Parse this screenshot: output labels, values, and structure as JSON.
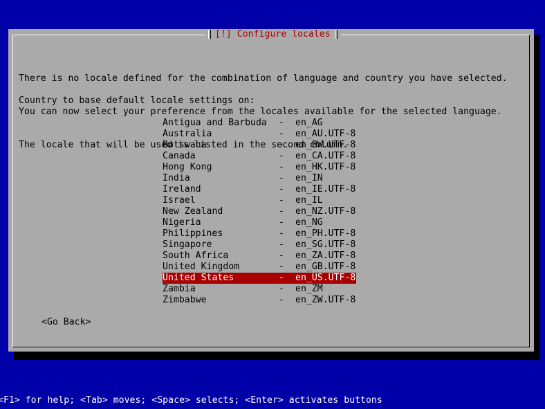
{
  "dialog": {
    "title": "[!] Configure locales",
    "description_lines": [
      "There is no locale defined for the combination of language and country you have selected.",
      "You can now select your preference from the locales available for the selected language.",
      "The locale that will be used is listed in the second column."
    ],
    "prompt": "Country to base default locale settings on:",
    "locales": [
      {
        "country": "Antigua and Barbuda",
        "locale": "en_AG"
      },
      {
        "country": "Australia",
        "locale": "en_AU.UTF-8"
      },
      {
        "country": "Botswana",
        "locale": "en_BW.UTF-8"
      },
      {
        "country": "Canada",
        "locale": "en_CA.UTF-8"
      },
      {
        "country": "Hong Kong",
        "locale": "en_HK.UTF-8"
      },
      {
        "country": "India",
        "locale": "en_IN"
      },
      {
        "country": "Ireland",
        "locale": "en_IE.UTF-8"
      },
      {
        "country": "Israel",
        "locale": "en_IL"
      },
      {
        "country": "New Zealand",
        "locale": "en_NZ.UTF-8"
      },
      {
        "country": "Nigeria",
        "locale": "en_NG"
      },
      {
        "country": "Philippines",
        "locale": "en_PH.UTF-8"
      },
      {
        "country": "Singapore",
        "locale": "en_SG.UTF-8"
      },
      {
        "country": "South Africa",
        "locale": "en_ZA.UTF-8"
      },
      {
        "country": "United Kingdom",
        "locale": "en_GB.UTF-8"
      },
      {
        "country": "United States",
        "locale": "en_US.UTF-8"
      },
      {
        "country": "Zambia",
        "locale": "en_ZM"
      },
      {
        "country": "Zimbabwe",
        "locale": "en_ZW.UTF-8"
      }
    ],
    "separator": "-",
    "selected_country": "United States",
    "go_back_label": "<Go Back>"
  },
  "status_bar": "<F1> for help; <Tab> moves; <Space> selects; <Enter> activates buttons",
  "colors": {
    "background": "#0000a8",
    "dialog": "#aaaaaa",
    "title": "#a80000",
    "selection": "#a80000"
  }
}
